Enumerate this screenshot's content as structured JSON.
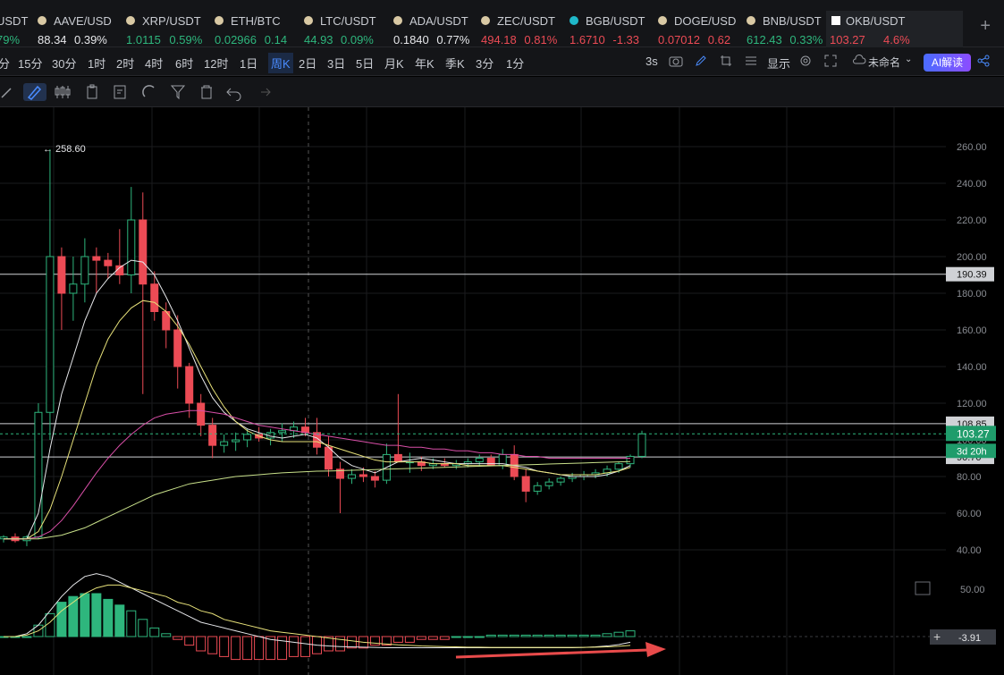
{
  "tickers": [
    {
      "symbol": "USDT",
      "price": "",
      "change": "79%",
      "change_dir": "up",
      "icon": "coin-icon"
    },
    {
      "symbol": "AAVE/USD",
      "price": "88.34",
      "change": "0.39%",
      "change_dir": "up",
      "icon": "coin-icon"
    },
    {
      "symbol": "XRP/USDT",
      "price": "1.0115",
      "change": "0.59%",
      "change_dir": "up",
      "icon": "coin-icon"
    },
    {
      "symbol": "ETH/BTC",
      "price": "0.02966",
      "change": "0.14",
      "change_dir": "up",
      "icon": "coin-icon"
    },
    {
      "symbol": "LTC/USDT",
      "price": "44.93",
      "change": "0.09%",
      "change_dir": "up",
      "icon": "coin-icon"
    },
    {
      "symbol": "ADA/USDT",
      "price": "0.1840",
      "change": "0.77%",
      "change_dir": "up",
      "icon": "coin-icon"
    },
    {
      "symbol": "ZEC/USDT",
      "price": "494.18",
      "change": "0.81%",
      "change_dir": "down",
      "icon": "coin-icon"
    },
    {
      "symbol": "BGB/USDT",
      "price": "1.6710",
      "change": "-1.33",
      "change_dir": "down",
      "icon": "bgb-icon"
    },
    {
      "symbol": "DOGE/USD",
      "price": "0.07012",
      "change": "0.62",
      "change_dir": "down",
      "icon": "coin-icon"
    },
    {
      "symbol": "BNB/USDT",
      "price": "612.43",
      "change": "0.33%",
      "change_dir": "up",
      "icon": "coin-icon"
    },
    {
      "symbol": "OKB/USDT",
      "price": "103.27",
      "change": "4.6%",
      "change_dir": "down",
      "icon": "okx-icon",
      "active": true
    }
  ],
  "timeframes": [
    "分",
    "15分",
    "30分",
    "1时",
    "2时",
    "4时",
    "6时",
    "12时",
    "1日",
    "周K",
    "2日",
    "3日",
    "5日",
    "月K",
    "年K",
    "季K",
    "3分",
    "1分"
  ],
  "selected_timeframe": "周K",
  "toolbar": {
    "interval": "3s",
    "display_label": "显示",
    "layout_name": "未命名",
    "ai_label": "AI解读"
  },
  "price_axis": [
    "260.00",
    "240.00",
    "220.00",
    "200.00",
    "180.00",
    "160.00",
    "140.00",
    "120.00",
    "100.00",
    "80.00",
    "60.00",
    "40.00"
  ],
  "horizontal_lines": {
    "upper": "190.39",
    "middle": "108.85",
    "lower": "90.70"
  },
  "current_price": "103.27",
  "countdown": "3d 20h",
  "high_label": "258.60",
  "macd_axis": "50.00",
  "macd_value": "-3.91",
  "colors": {
    "up": "#2eb67d",
    "down": "#ec4b55",
    "accent": "#4a8cff"
  },
  "chart_data": {
    "type": "candlestick",
    "ylim": [
      30,
      275
    ],
    "candles": [
      {
        "o": 46,
        "h": 48,
        "l": 44,
        "c": 47
      },
      {
        "o": 47,
        "h": 49,
        "l": 44,
        "c": 45
      },
      {
        "o": 45,
        "h": 48,
        "l": 42,
        "c": 47
      },
      {
        "o": 47,
        "h": 120,
        "l": 46,
        "c": 115
      },
      {
        "o": 115,
        "h": 258.6,
        "l": 100,
        "c": 200
      },
      {
        "o": 200,
        "h": 205,
        "l": 160,
        "c": 180
      },
      {
        "o": 180,
        "h": 200,
        "l": 165,
        "c": 185
      },
      {
        "o": 185,
        "h": 210,
        "l": 175,
        "c": 200
      },
      {
        "o": 200,
        "h": 205,
        "l": 180,
        "c": 198
      },
      {
        "o": 198,
        "h": 202,
        "l": 188,
        "c": 195
      },
      {
        "o": 195,
        "h": 215,
        "l": 185,
        "c": 190
      },
      {
        "o": 190,
        "h": 238,
        "l": 180,
        "c": 220
      },
      {
        "o": 220,
        "h": 235,
        "l": 125,
        "c": 185
      },
      {
        "o": 185,
        "h": 192,
        "l": 165,
        "c": 170
      },
      {
        "o": 170,
        "h": 175,
        "l": 150,
        "c": 160
      },
      {
        "o": 160,
        "h": 168,
        "l": 128,
        "c": 140
      },
      {
        "o": 140,
        "h": 142,
        "l": 112,
        "c": 120
      },
      {
        "o": 120,
        "h": 125,
        "l": 102,
        "c": 108
      },
      {
        "o": 108,
        "h": 112,
        "l": 90,
        "c": 97
      },
      {
        "o": 97,
        "h": 103,
        "l": 93,
        "c": 99
      },
      {
        "o": 99,
        "h": 104,
        "l": 94,
        "c": 100
      },
      {
        "o": 100,
        "h": 106,
        "l": 96,
        "c": 103
      },
      {
        "o": 103,
        "h": 107,
        "l": 99,
        "c": 101
      },
      {
        "o": 101,
        "h": 106,
        "l": 97,
        "c": 104
      },
      {
        "o": 104,
        "h": 109,
        "l": 99,
        "c": 105
      },
      {
        "o": 105,
        "h": 110,
        "l": 101,
        "c": 107
      },
      {
        "o": 107,
        "h": 112,
        "l": 102,
        "c": 104
      },
      {
        "o": 104,
        "h": 112,
        "l": 92,
        "c": 96
      },
      {
        "o": 96,
        "h": 102,
        "l": 80,
        "c": 84
      },
      {
        "o": 84,
        "h": 88,
        "l": 60,
        "c": 79
      },
      {
        "o": 79,
        "h": 84,
        "l": 76,
        "c": 81
      },
      {
        "o": 81,
        "h": 85,
        "l": 77,
        "c": 80
      },
      {
        "o": 80,
        "h": 83,
        "l": 74,
        "c": 78
      },
      {
        "o": 78,
        "h": 98,
        "l": 76,
        "c": 92
      },
      {
        "o": 92,
        "h": 125,
        "l": 88,
        "c": 88
      },
      {
        "o": 88,
        "h": 93,
        "l": 82,
        "c": 88
      },
      {
        "o": 88,
        "h": 91,
        "l": 83,
        "c": 86
      },
      {
        "o": 86,
        "h": 90,
        "l": 84,
        "c": 87
      },
      {
        "o": 87,
        "h": 90,
        "l": 85,
        "c": 86
      },
      {
        "o": 86,
        "h": 89,
        "l": 84,
        "c": 87
      },
      {
        "o": 87,
        "h": 90,
        "l": 85,
        "c": 88
      },
      {
        "o": 88,
        "h": 92,
        "l": 86,
        "c": 90
      },
      {
        "o": 90,
        "h": 92,
        "l": 86,
        "c": 86
      },
      {
        "o": 86,
        "h": 95,
        "l": 84,
        "c": 92
      },
      {
        "o": 92,
        "h": 97,
        "l": 78,
        "c": 80
      },
      {
        "o": 80,
        "h": 84,
        "l": 66,
        "c": 72
      },
      {
        "o": 72,
        "h": 77,
        "l": 70,
        "c": 75
      },
      {
        "o": 75,
        "h": 79,
        "l": 73,
        "c": 77
      },
      {
        "o": 77,
        "h": 80,
        "l": 75,
        "c": 79
      },
      {
        "o": 79,
        "h": 82,
        "l": 77,
        "c": 80
      },
      {
        "o": 80,
        "h": 83,
        "l": 78,
        "c": 81
      },
      {
        "o": 81,
        "h": 84,
        "l": 79,
        "c": 82
      },
      {
        "o": 82,
        "h": 86,
        "l": 80,
        "c": 84
      },
      {
        "o": 84,
        "h": 88,
        "l": 82,
        "c": 87
      },
      {
        "o": 87,
        "h": 92,
        "l": 85,
        "c": 91
      },
      {
        "o": 91,
        "h": 105,
        "l": 90,
        "c": 103.27
      }
    ],
    "ma_white": [
      46,
      46,
      46,
      60,
      95,
      125,
      145,
      165,
      180,
      188,
      194,
      198,
      197,
      190,
      178,
      165,
      150,
      135,
      123,
      115,
      110,
      106,
      104,
      102,
      101,
      102,
      103,
      101,
      96,
      90,
      86,
      84,
      82,
      85,
      88,
      89,
      90,
      89,
      88,
      87,
      87,
      87,
      87,
      87,
      86,
      85,
      83,
      82,
      81,
      80,
      80,
      80,
      81,
      83,
      86
    ],
    "ma_yellow": [
      46,
      46,
      46,
      50,
      62,
      80,
      100,
      120,
      140,
      155,
      165,
      172,
      176,
      175,
      170,
      162,
      152,
      140,
      128,
      118,
      110,
      105,
      102,
      100,
      99,
      99,
      99,
      99,
      97,
      95,
      93,
      91,
      89,
      88,
      88,
      88,
      88,
      87,
      87,
      87,
      86,
      86,
      86,
      86,
      85,
      84,
      83,
      82,
      81,
      81,
      81,
      81,
      82,
      83,
      85
    ],
    "ma_pink": [
      46,
      46,
      46,
      47,
      50,
      56,
      64,
      73,
      82,
      90,
      97,
      103,
      108,
      112,
      114,
      115,
      116,
      116,
      115,
      114,
      112,
      110,
      108,
      107,
      106,
      105,
      104,
      103,
      102,
      101,
      100,
      99,
      98,
      97,
      97,
      96,
      96,
      95,
      95,
      94,
      94,
      93,
      93,
      92,
      92,
      91,
      91,
      90,
      90,
      90,
      90,
      90,
      90,
      90,
      90
    ],
    "ma_green": [
      46,
      46,
      46,
      46,
      47,
      48,
      50,
      52,
      55,
      58,
      61,
      64,
      67,
      70,
      72,
      74,
      76,
      77,
      78,
      79,
      80,
      80.5,
      81,
      81.5,
      82,
      82.3,
      82.6,
      82.9,
      83,
      83.2,
      83.4,
      83.6,
      83.8,
      84,
      84.2,
      84.4,
      84.6,
      84.8,
      85,
      85.2,
      85.4,
      85.6,
      85.8,
      86,
      86.2,
      86.4,
      86.6,
      86.8,
      87,
      87.2,
      87.4,
      87.6,
      87.8,
      88,
      88.2
    ],
    "macd_hist": [
      0,
      0,
      0,
      4,
      8,
      12,
      14,
      15,
      15,
      13,
      11,
      9,
      6,
      3,
      1,
      -1,
      -3,
      -5,
      -6,
      -7,
      -8,
      -8,
      -8,
      -8,
      -8,
      -7,
      -7,
      -6,
      -5,
      -5,
      -4,
      -4,
      -3,
      -3,
      -2,
      -2,
      -1,
      -1,
      -1,
      0,
      0,
      0,
      0.5,
      0.5,
      0.5,
      0.5,
      0.5,
      0.5,
      0.5,
      0.5,
      0.5,
      0.5,
      1,
      1.5,
      2
    ],
    "macd_line": [
      0,
      0,
      1,
      4,
      9,
      14,
      18,
      21,
      22,
      21,
      19,
      17,
      15,
      13,
      11,
      9,
      7,
      5,
      4,
      3,
      2,
      1,
      0,
      -1,
      -1.5,
      -2,
      -2.5,
      -3,
      -3.3,
      -3.5,
      -3.6,
      -3.7,
      -3.8,
      -3.9,
      -3.9,
      -3.9,
      -3.9,
      -3.9,
      -3.9,
      -3.9,
      -3.9,
      -3.9,
      -3.9,
      -3.9,
      -3.9,
      -3.9,
      -3.9,
      -3.9,
      -3.9,
      -3.9,
      -3.8,
      -3.6,
      -3.3,
      -2.8,
      -2
    ],
    "signal_line": [
      0,
      0,
      0.5,
      2,
      5,
      9,
      12,
      15,
      17,
      18,
      18,
      17,
      16,
      15,
      14,
      12,
      11,
      9,
      8,
      6,
      5,
      4,
      3,
      2,
      1.5,
      1,
      0.5,
      0,
      -0.5,
      -1,
      -1.5,
      -2,
      -2.3,
      -2.6,
      -2.9,
      -3.1,
      -3.3,
      -3.4,
      -3.5,
      -3.6,
      -3.7,
      -3.7,
      -3.8,
      -3.8,
      -3.8,
      -3.8,
      -3.8,
      -3.8,
      -3.8,
      -3.8,
      -3.8,
      -3.7,
      -3.6,
      -3.4,
      -3.1
    ]
  }
}
